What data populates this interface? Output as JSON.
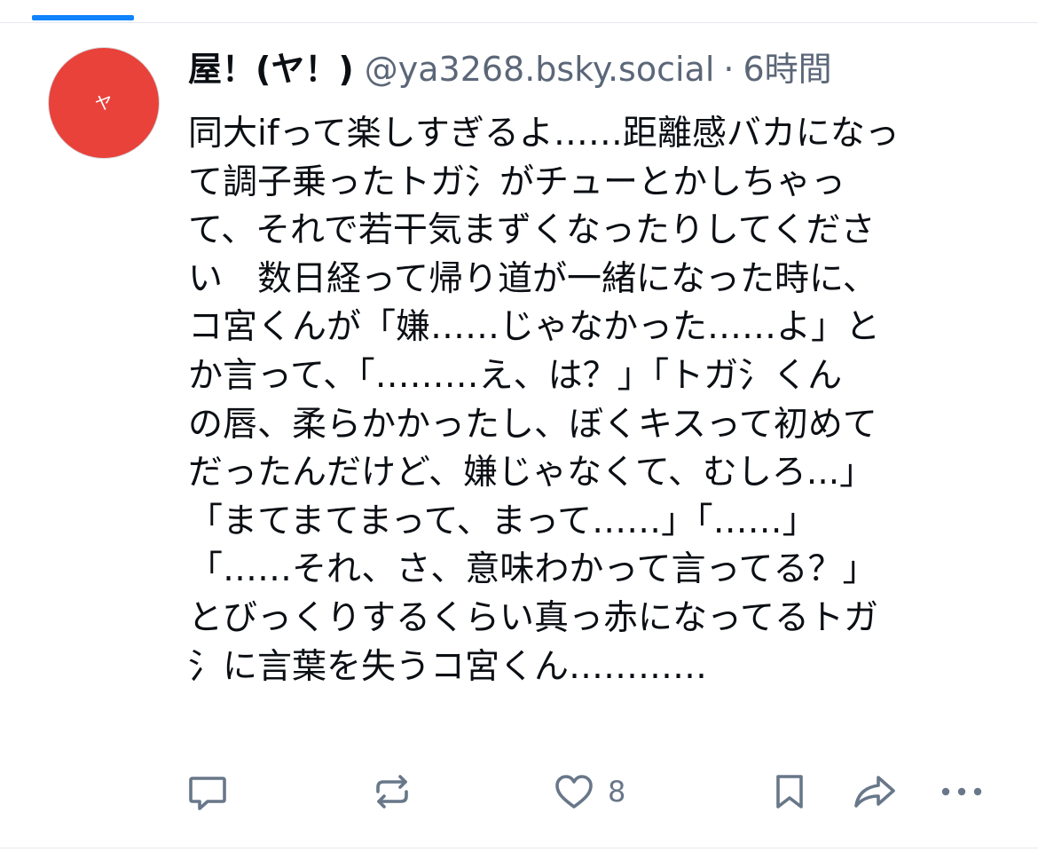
{
  "post": {
    "avatar_glyph": "ヤ",
    "display_name": "屋！(ヤ！)",
    "handle": "@ya3268.bsky.social",
    "separator": "·",
    "time": "6時間",
    "body_lines": [
      "同大ifって楽しすぎるよ……距離感バカになっ",
      "て調子乗ったトガ氵がチューとかしちゃっ",
      "て、それで若干気まずくなったりしてくださ",
      "い　数日経って帰り道が一緒になった時に、",
      "コ宮くんが「嫌……じゃなかった……よ」と",
      "か言って、「………え、は？」「トガ氵くん",
      "の唇、柔らかかったし、ぼくキスって初めて",
      "だったんだけど、嫌じゃなくて、むしろ...」",
      "「まてまてまって、まって……」「……」",
      "「……それ、さ、意味わかって言ってる？」",
      "とびっくりするくらい真っ赤になってるトガ",
      "氵に言葉を失うコ宮くん…………"
    ]
  },
  "actions": {
    "reply_icon": "reply-icon",
    "repost_icon": "repost-icon",
    "like_icon": "heart-icon",
    "like_count": "8",
    "bookmark_icon": "bookmark-icon",
    "share_icon": "share-icon",
    "more_icon": "more-icon"
  },
  "colors": {
    "tab_indicator": "#1083fe",
    "avatar": "#e8423a",
    "muted_text": "#5b6778",
    "icon": "#687789"
  }
}
